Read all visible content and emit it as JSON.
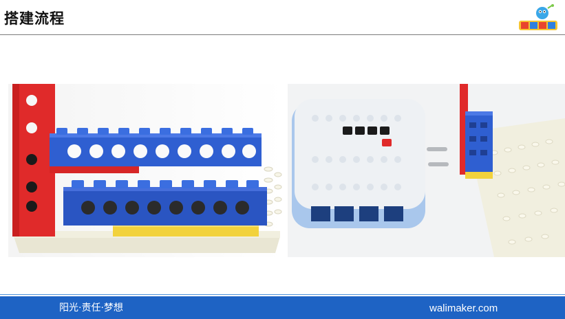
{
  "header": {
    "title": "搭建流程",
    "logo_icon": "wali-maker-robot-logo"
  },
  "photos": [
    {
      "icon": "lego-beam-assembly-photo",
      "subject": "red vertical beam with two blue technic beams on white baseplate"
    },
    {
      "icon": "controller-box-and-pins-photo",
      "subject": "white controller box, two grey pins, blue beam stack on white baseplate"
    }
  ],
  "footer": {
    "slogan": "阳光·责任·梦想",
    "website": "walimaker.com"
  },
  "colors": {
    "footer_bg": "#1e63c4",
    "title_text": "#111111",
    "lego_red": "#e02a2a",
    "lego_blue": "#2f5fd1",
    "lego_yellow": "#f2d23c",
    "baseplate": "#efeedd"
  }
}
